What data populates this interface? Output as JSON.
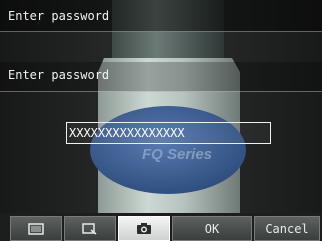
{
  "prompts": {
    "top": "Enter password",
    "middle": "Enter password"
  },
  "password_field": {
    "value": "XXXXXXXXXXXXXXXX"
  },
  "camera_label": {
    "text": "FQ Series"
  },
  "toolbar": {
    "buttons": [
      {
        "icon": "full-view-icon"
      },
      {
        "icon": "zoom-view-icon"
      },
      {
        "icon": "camera-icon"
      },
      {
        "label": "OK"
      },
      {
        "label": "Cancel"
      }
    ]
  },
  "colors": {
    "text": "#f2f4f2",
    "bottle": "#b8c5bf",
    "label_ellipse": "#3d5d8e"
  }
}
